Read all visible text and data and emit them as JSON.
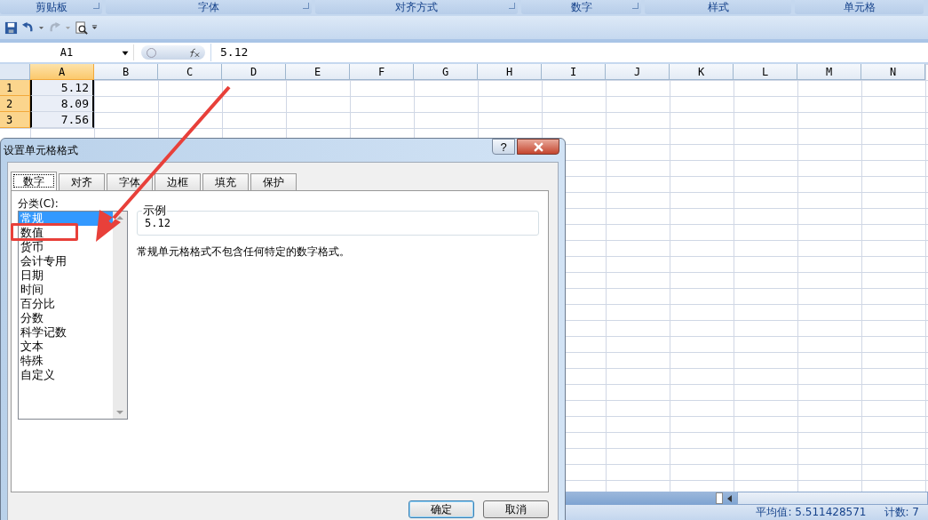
{
  "ribbon_groups": [
    {
      "label": "剪贴板",
      "launcher": true
    },
    {
      "label": "字体",
      "launcher": true
    },
    {
      "label": "对齐方式",
      "launcher": true
    },
    {
      "label": "数字",
      "launcher": true
    },
    {
      "label": "样式",
      "launcher": false
    },
    {
      "label": "单元格",
      "launcher": false
    }
  ],
  "formula_bar": {
    "name_box": "A1",
    "value": "5.12"
  },
  "columns": [
    {
      "label": "A",
      "selected": true
    },
    {
      "label": "B",
      "selected": false
    },
    {
      "label": "C",
      "selected": false
    },
    {
      "label": "D",
      "selected": false
    },
    {
      "label": "E",
      "selected": false
    },
    {
      "label": "F",
      "selected": false
    },
    {
      "label": "G",
      "selected": false
    },
    {
      "label": "H",
      "selected": false
    },
    {
      "label": "I",
      "selected": false
    },
    {
      "label": "J",
      "selected": false
    },
    {
      "label": "K",
      "selected": false
    },
    {
      "label": "L",
      "selected": false
    },
    {
      "label": "M",
      "selected": false
    },
    {
      "label": "N",
      "selected": false
    }
  ],
  "rows": [
    {
      "number": "1",
      "selected": true,
      "value": "5.12"
    },
    {
      "number": "2",
      "selected": true,
      "value": "8.09"
    },
    {
      "number": "3",
      "selected": true,
      "value": "7.56"
    }
  ],
  "dialog": {
    "title": "设置单元格格式",
    "help": "?",
    "tabs": [
      {
        "label": "数字",
        "selected": true
      },
      {
        "label": "对齐",
        "selected": false
      },
      {
        "label": "字体",
        "selected": false
      },
      {
        "label": "边框",
        "selected": false
      },
      {
        "label": "填充",
        "selected": false
      },
      {
        "label": "保护",
        "selected": false
      }
    ],
    "category_label": "分类(C):",
    "categories": [
      {
        "label": "常规",
        "selected": true
      },
      {
        "label": "数值",
        "selected": false
      },
      {
        "label": "货币",
        "selected": false
      },
      {
        "label": "会计专用",
        "selected": false
      },
      {
        "label": "日期",
        "selected": false
      },
      {
        "label": "时间",
        "selected": false
      },
      {
        "label": "百分比",
        "selected": false
      },
      {
        "label": "分数",
        "selected": false
      },
      {
        "label": "科学记数",
        "selected": false
      },
      {
        "label": "文本",
        "selected": false
      },
      {
        "label": "特殊",
        "selected": false
      },
      {
        "label": "自定义",
        "selected": false
      }
    ],
    "sample": {
      "legend": "示例",
      "value": "5.12"
    },
    "description": "常规单元格格式不包含任何特定的数字格式。",
    "buttons": [
      "确定",
      "取消"
    ]
  },
  "status_bar": {
    "average": "平均值: 5.511428571",
    "count": "计数: 7"
  }
}
